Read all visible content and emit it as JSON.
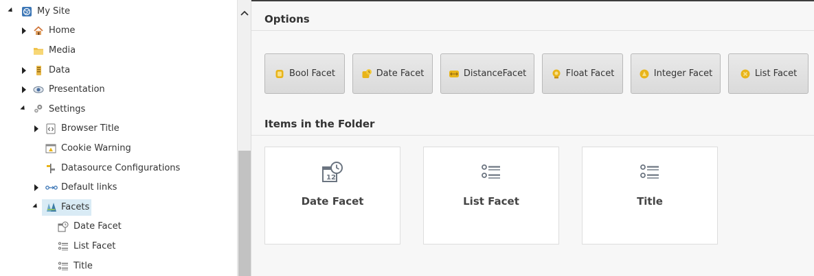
{
  "tree": {
    "root": {
      "label": "My Site",
      "icon": "globe-icon"
    },
    "items": [
      {
        "label": "Home",
        "icon": "home-icon"
      },
      {
        "label": "Media",
        "icon": "folder-icon"
      },
      {
        "label": "Data",
        "icon": "database-icon"
      },
      {
        "label": "Presentation",
        "icon": "eye-icon"
      },
      {
        "label": "Settings",
        "icon": "gears-icon"
      },
      {
        "label": "Browser Title",
        "icon": "code-page-icon"
      },
      {
        "label": "Cookie Warning",
        "icon": "window-warning-icon"
      },
      {
        "label": "Datasource Configurations",
        "icon": "signpost-icon"
      },
      {
        "label": "Default links",
        "icon": "link-chain-icon"
      },
      {
        "label": "Facets",
        "icon": "facets-icon"
      },
      {
        "label": "Date Facet",
        "icon": "calendar-clock-icon"
      },
      {
        "label": "List Facet",
        "icon": "list-icon"
      },
      {
        "label": "Title",
        "icon": "list-icon"
      }
    ]
  },
  "options": {
    "title": "Options",
    "buttons": [
      {
        "label": "Bool Facet",
        "icon": "bool-facet-icon"
      },
      {
        "label": "Date Facet",
        "icon": "date-facet-icon"
      },
      {
        "label": "DistanceFacet",
        "icon": "distance-facet-icon"
      },
      {
        "label": "Float Facet",
        "icon": "float-facet-icon"
      },
      {
        "label": "Integer Facet",
        "icon": "integer-facet-icon"
      },
      {
        "label": "List Facet",
        "icon": "list-facet-icon"
      }
    ]
  },
  "folder": {
    "title": "Items in the Folder",
    "items": [
      {
        "label": "Date Facet",
        "icon": "calendar-clock-icon"
      },
      {
        "label": "List Facet",
        "icon": "list-icon"
      },
      {
        "label": "Title",
        "icon": "list-icon"
      }
    ]
  },
  "colors": {
    "selection": "#d9ebf5",
    "facet_icon_gold": "#e8b41a",
    "card_icon_gray": "#6b7480"
  }
}
